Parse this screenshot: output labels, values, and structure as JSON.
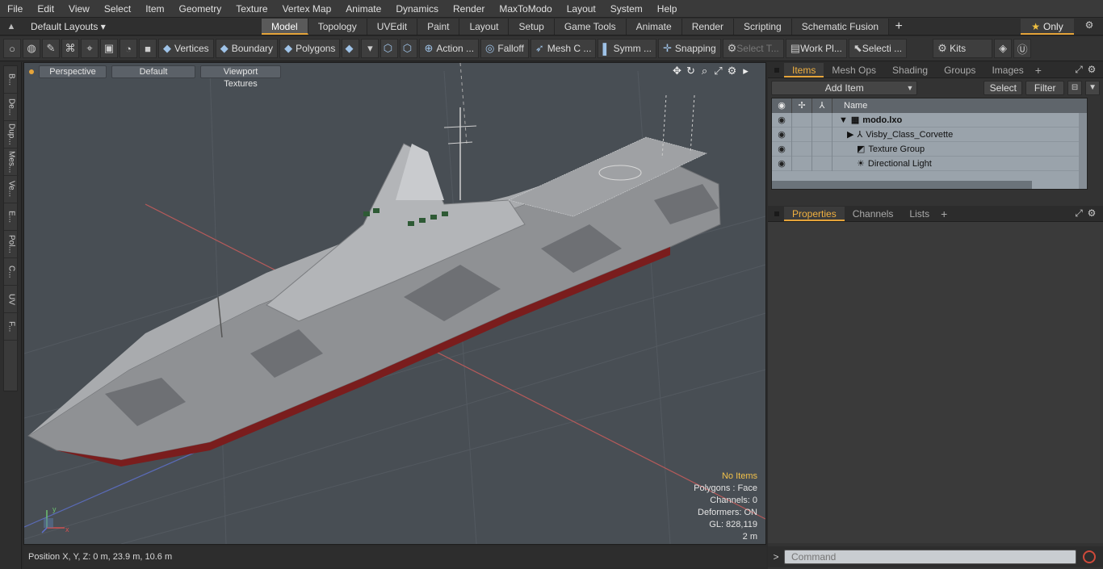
{
  "menu": [
    "File",
    "Edit",
    "View",
    "Select",
    "Item",
    "Geometry",
    "Texture",
    "Vertex Map",
    "Animate",
    "Dynamics",
    "Render",
    "MaxToModo",
    "Layout",
    "System",
    "Help"
  ],
  "layouts": {
    "label": "Default Layouts ▾"
  },
  "layout_tabs": [
    {
      "label": "Model",
      "active": true
    },
    {
      "label": "Topology"
    },
    {
      "label": "UVEdit"
    },
    {
      "label": "Paint"
    },
    {
      "label": "Layout"
    },
    {
      "label": "Setup"
    },
    {
      "label": "Game Tools"
    },
    {
      "label": "Animate"
    },
    {
      "label": "Render"
    },
    {
      "label": "Scripting"
    },
    {
      "label": "Schematic Fusion"
    }
  ],
  "only_label": "Only",
  "toolbar": {
    "vertices": "Vertices",
    "boundary": "Boundary",
    "polygons": "Polygons",
    "action": "Action ...",
    "falloff": "Falloff",
    "mesh": "Mesh C ...",
    "symm": "Symm ...",
    "snapping": "Snapping",
    "select_t": "Select T...",
    "workplane": "Work Pl...",
    "selecti": "Selecti ...",
    "kits": "Kits"
  },
  "left_tabs": [
    "B...",
    "De...",
    "Dup...",
    "Mes...",
    "Ve...",
    "E...",
    "Pol...",
    "C...",
    "UV",
    "F..."
  ],
  "viewport": {
    "view": "Perspective",
    "shading": "Default",
    "textures": "Viewport Textures",
    "info": {
      "no_items": "No Items",
      "polygons": "Polygons : Face",
      "channels": "Channels: 0",
      "deformers": "Deformers: ON",
      "gl": "GL: 828,119",
      "scale": "2 m"
    }
  },
  "status": {
    "position": "Position X, Y, Z:   0 m, 23.9 m, 10.6 m"
  },
  "items_panel": {
    "tabs": [
      {
        "label": "Items",
        "active": true
      },
      {
        "label": "Mesh Ops"
      },
      {
        "label": "Shading"
      },
      {
        "label": "Groups"
      },
      {
        "label": "Images"
      }
    ],
    "add_item": "Add Item",
    "select": "Select",
    "filter": "Filter",
    "name_col": "Name",
    "rows": [
      {
        "label": "modo.lxo"
      },
      {
        "label": "Visby_Class_Corvette"
      },
      {
        "label": "Texture Group"
      },
      {
        "label": "Directional Light"
      }
    ]
  },
  "props_panel": {
    "tabs": [
      {
        "label": "Properties",
        "active": true
      },
      {
        "label": "Channels"
      },
      {
        "label": "Lists"
      }
    ]
  },
  "command": {
    "placeholder": "Command"
  },
  "colors": {
    "accent": "#e5a43a",
    "viewport_bg": "#484e54",
    "tree_bg": "#9aa3ab"
  }
}
